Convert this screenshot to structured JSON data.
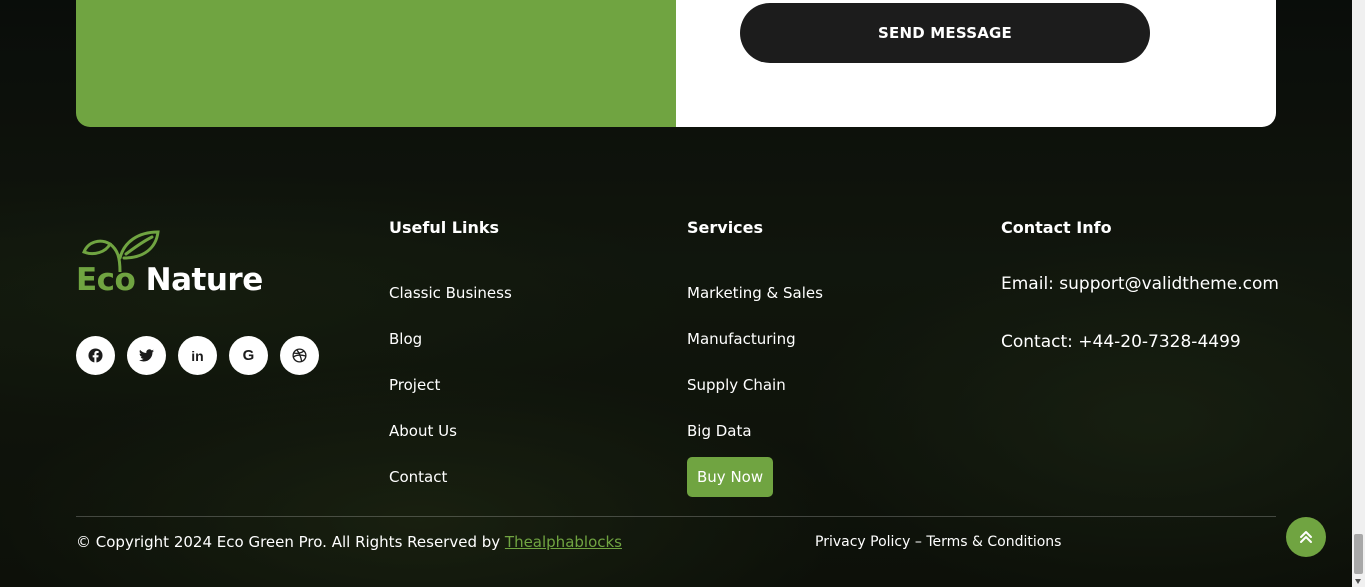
{
  "contact_form": {
    "send_label": "SEND MESSAGE"
  },
  "logo": {
    "word_eco": "Eco",
    "word_nature": "Nature",
    "icon": "leaf-icon"
  },
  "social": [
    {
      "icon": "facebook-icon",
      "glyph": "f"
    },
    {
      "icon": "twitter-icon",
      "glyph": "t"
    },
    {
      "icon": "linkedin-icon",
      "glyph": "in"
    },
    {
      "icon": "google-icon",
      "glyph": "G"
    },
    {
      "icon": "dribbble-icon",
      "glyph": "dribbble"
    }
  ],
  "useful_links": {
    "title": "Useful Links",
    "items": [
      "Classic Business",
      "Blog",
      "Project",
      "About Us",
      "Contact"
    ]
  },
  "services": {
    "title": "Services",
    "items": [
      "Marketing & Sales",
      "Manufacturing",
      "Supply Chain",
      "Big Data"
    ],
    "buy_label": "Buy Now"
  },
  "contact_info": {
    "title": "Contact Info",
    "email": "Email: support@validtheme.com",
    "phone": "Contact: +44-20-7328-4499"
  },
  "footer": {
    "copyright_prefix": "© Copyright 2024 Eco Green Pro. All Rights Reserved by ",
    "copyright_link": "Thealphablocks",
    "privacy": "Privacy Policy",
    "separator": "–",
    "terms": "Terms & Conditions"
  },
  "colors": {
    "accent": "#70a441",
    "dark_button": "#1c1c1c"
  }
}
